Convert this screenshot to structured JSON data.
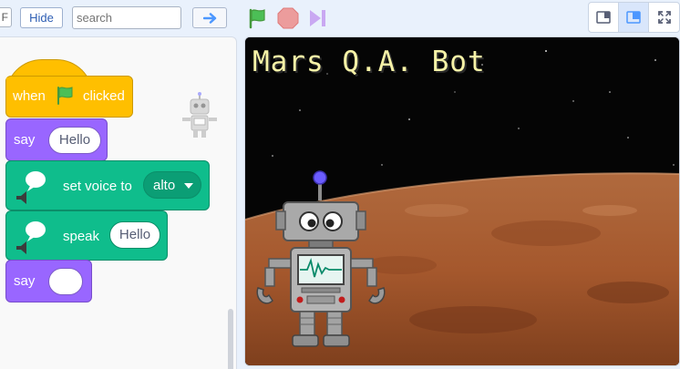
{
  "toolbar": {
    "f_label": "F",
    "hide_label": "Hide",
    "search_placeholder": "search",
    "go_icon": "arrow-right-icon",
    "green_flag_icon": "green-flag-icon",
    "stop_icon": "stop-icon",
    "pause_icon": "pause-icon",
    "view_small_icon": "small-stage-icon",
    "view_large_icon": "large-stage-icon",
    "fullscreen_icon": "fullscreen-icon"
  },
  "code": {
    "hat": {
      "when": "when",
      "clicked": "clicked"
    },
    "say1": {
      "label": "say",
      "value": "Hello"
    },
    "set_voice": {
      "label": "set voice to",
      "value": "alto"
    },
    "speak": {
      "label": "speak",
      "value": "Hello"
    },
    "say2": {
      "label": "say",
      "value": ""
    }
  },
  "stage": {
    "title": "Mars Q.A. Bot"
  },
  "colors": {
    "events": "#ffbf00",
    "looks": "#9966ff",
    "tts": "#0fbd8c",
    "accent": "#4c97ff"
  }
}
